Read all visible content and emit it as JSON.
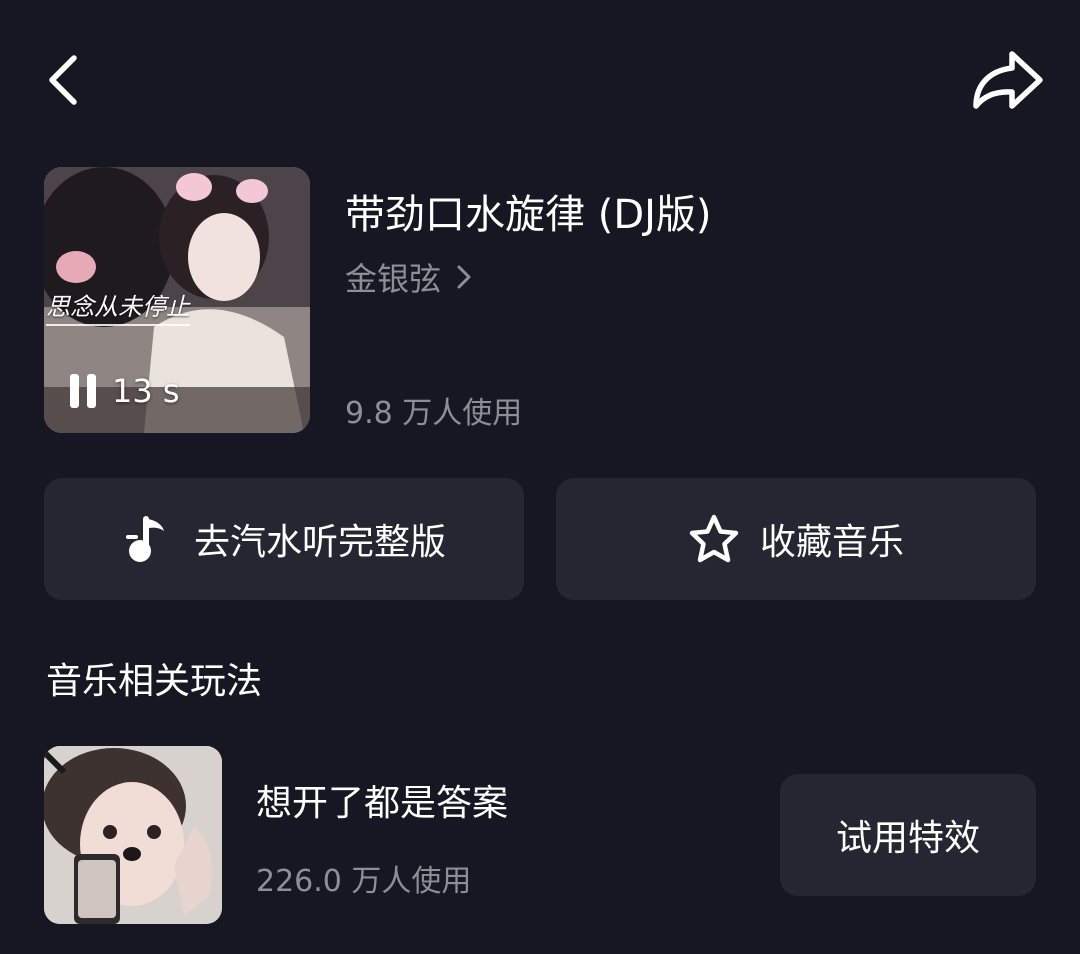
{
  "colors": {
    "background": "#161722",
    "button_bg": "#252632",
    "text_primary": "#ffffff",
    "text_secondary": "#8d8e96"
  },
  "header": {
    "back_icon": "chevron-left-icon",
    "share_icon": "share-arrow-icon"
  },
  "music": {
    "cover_caption": "思念从未停止",
    "duration": "13 s",
    "playback_icon": "pause-icon",
    "title": "带劲口水旋律 (DJ版)",
    "artist": "金银弦",
    "usage": "9.8 万人使用"
  },
  "actions": {
    "qishui_label": "去汽水听完整版",
    "qishui_icon": "music-note-icon",
    "favorite_label": "收藏音乐",
    "favorite_icon": "star-outline-icon"
  },
  "related": {
    "section_title": "音乐相关玩法",
    "items": [
      {
        "name": "想开了都是答案",
        "usage": "226.0 万人使用",
        "button_label": "试用特效"
      }
    ]
  }
}
